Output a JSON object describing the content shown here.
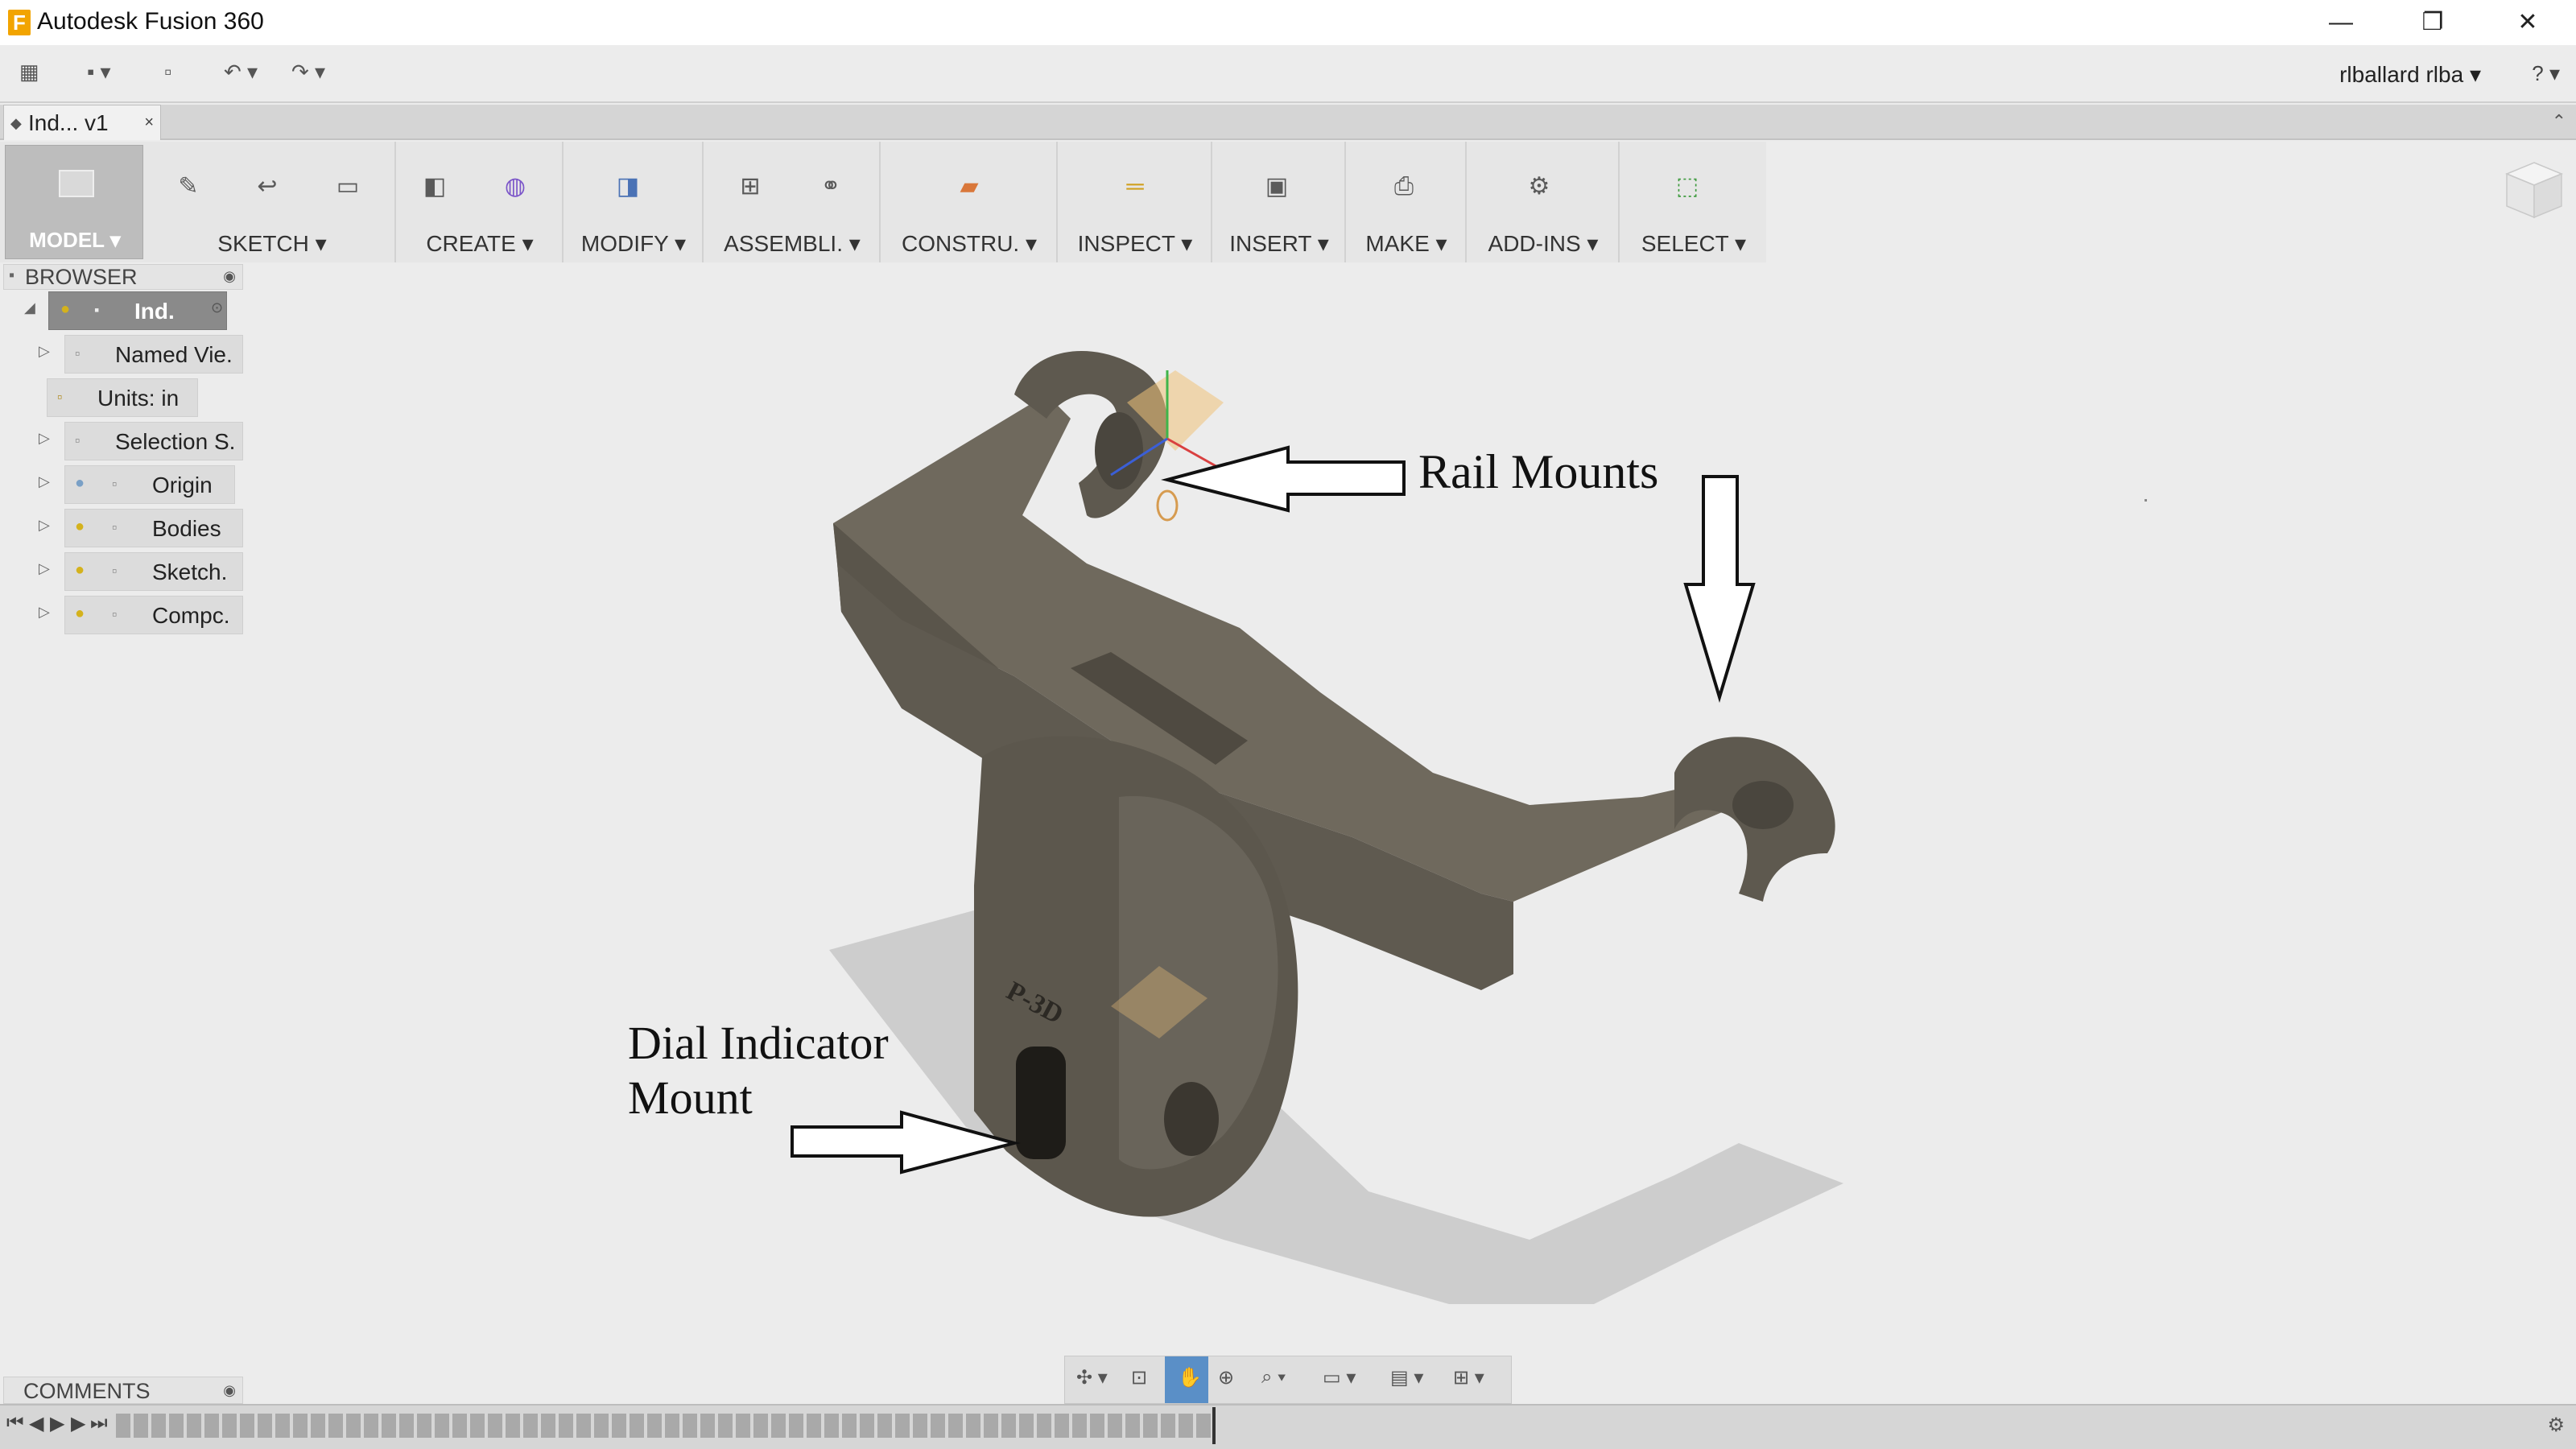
{
  "window": {
    "title": "Autodesk Fusion 360",
    "logo_letter": "F",
    "minimize": "—",
    "restore": "❐",
    "close": "✕"
  },
  "quick_access": {
    "data_panel_icon": "grid-icon",
    "file_icon": "file-icon",
    "save_icon": "save-icon",
    "undo_icon": "undo-icon",
    "redo_icon": "redo-icon",
    "user": "rlballard rlba ▾",
    "help": "? ▾"
  },
  "document_tab": {
    "label": "Ind... v1",
    "close": "×"
  },
  "toolbar": {
    "workspace": "MODEL ▾",
    "groups": [
      {
        "label": "SKETCH ▾",
        "icons": [
          "sketch-icon",
          "arc-icon",
          "rectangle-icon"
        ]
      },
      {
        "label": "CREATE ▾",
        "icons": [
          "box-icon",
          "sphere-icon"
        ]
      },
      {
        "label": "MODIFY ▾",
        "icons": [
          "press-pull-icon"
        ]
      },
      {
        "label": "ASSEMBLI. ▾",
        "icons": [
          "new-component-icon",
          "joint-icon"
        ]
      },
      {
        "label": "CONSTRU. ▾",
        "icons": [
          "plane-icon"
        ]
      },
      {
        "label": "INSPECT ▾",
        "icons": [
          "measure-icon"
        ]
      },
      {
        "label": "INSERT ▾",
        "icons": [
          "image-icon"
        ]
      },
      {
        "label": "MAKE ▾",
        "icons": [
          "print-icon"
        ]
      },
      {
        "label": "ADD-INS ▾",
        "icons": [
          "scripts-icon"
        ]
      },
      {
        "label": "SELECT ▾",
        "icons": [
          "select-icon"
        ]
      }
    ]
  },
  "browser": {
    "title": "BROWSER",
    "items": [
      {
        "label": "Ind.",
        "active": true
      },
      {
        "label": "Named Vie."
      },
      {
        "label": "Units: in"
      },
      {
        "label": "Selection S."
      },
      {
        "label": "Origin"
      },
      {
        "label": "Bodies"
      },
      {
        "label": "Sketch."
      },
      {
        "label": "Compc."
      }
    ]
  },
  "annotations": {
    "rail_mounts": "Rail Mounts",
    "dial_line1": "Dial Indicator",
    "dial_line2": "Mount"
  },
  "model": {
    "engraving": "P-3D",
    "body_color": "#6e675b",
    "shadow_color": "#c7c7c7",
    "sketch_plane_color": "#f0c27a"
  },
  "comments": {
    "label": "COMMENTS"
  },
  "colors": {
    "accent": "#5a8fc7",
    "toolbar_bg": "#e6e6e6",
    "active_row": "#8a8a8a"
  }
}
